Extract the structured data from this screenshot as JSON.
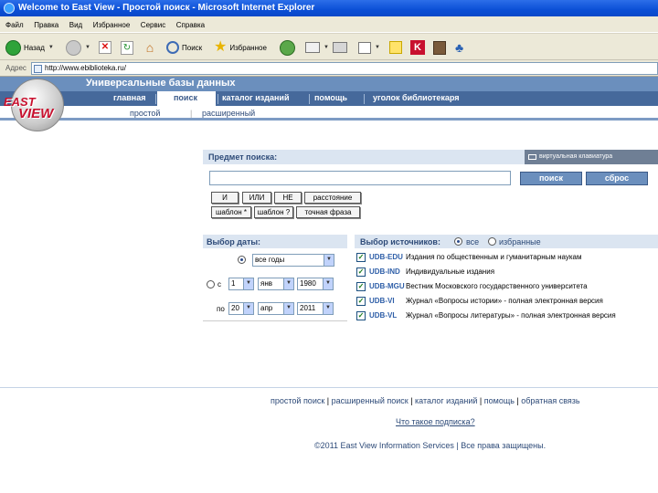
{
  "window": {
    "title": "Welcome to East View - Простой поиск - Microsoft Internet Explorer"
  },
  "menu": [
    "Файл",
    "Правка",
    "Вид",
    "Избранное",
    "Сервис",
    "Справка"
  ],
  "toolbar": {
    "back": "Назад",
    "search": "Поиск",
    "favorites": "Избранное"
  },
  "address": {
    "label": "Адрес",
    "url": "http://www.ebiblioteka.ru/"
  },
  "logo": {
    "line1": "EAST",
    "line2": "VIEW"
  },
  "header": {
    "title": "Универсальные базы данных",
    "nav": [
      "главная",
      "поиск",
      "каталог изданий",
      "помощь",
      "уголок библиотекаря"
    ],
    "active_index": 1,
    "sub": [
      "простой",
      "расширенный"
    ]
  },
  "search": {
    "heading": "Предмет поиска:",
    "virtual_keyboard": "виртуальная клавиатура",
    "query": "",
    "submit_label": "поиск",
    "reset_label": "сброс",
    "operators": [
      "И",
      "ИЛИ",
      "НЕ",
      "расстояние",
      "шаблон *",
      "шаблон ?",
      "точная фраза"
    ]
  },
  "dates": {
    "heading": "Выбор даты:",
    "period": "все годы",
    "from_label": "с",
    "from": {
      "day": "1",
      "month": "янв",
      "year": "1980"
    },
    "to_label": "по",
    "to": {
      "day": "20",
      "month": "апр",
      "year": "2011"
    }
  },
  "sources": {
    "heading": "Выбор источников:",
    "all_label": "все",
    "selected_label": "избранные",
    "items": [
      {
        "code": "UDB-EDU",
        "name": "Издания по общественным и гуманитарным наукам",
        "checked": true
      },
      {
        "code": "UDB-IND",
        "name": "Индивидуальные издания",
        "checked": true
      },
      {
        "code": "UDB-MGU",
        "name": "Вестник Московского государственного университета",
        "checked": true
      },
      {
        "code": "UDB-VI",
        "name": "Журнал «Вопросы истории» - полная электронная версия",
        "checked": true
      },
      {
        "code": "UDB-VL",
        "name": "Журнал «Вопросы литературы» - полная электронная версия",
        "checked": true
      }
    ]
  },
  "footer": {
    "links": [
      "простой поиск",
      "расширенный поиск",
      "каталог изданий",
      "помощь",
      "обратная связь"
    ],
    "question": "Что такое подписка?",
    "copyright": "©2011 East View Information Services | Все права защищены."
  },
  "colors": {
    "title_bar": "#0b4fd6",
    "header_top": "#6b8fbd",
    "header_nav": "#46699b",
    "logo_red": "#c8102e",
    "panel_bg": "#dbe5f1"
  }
}
